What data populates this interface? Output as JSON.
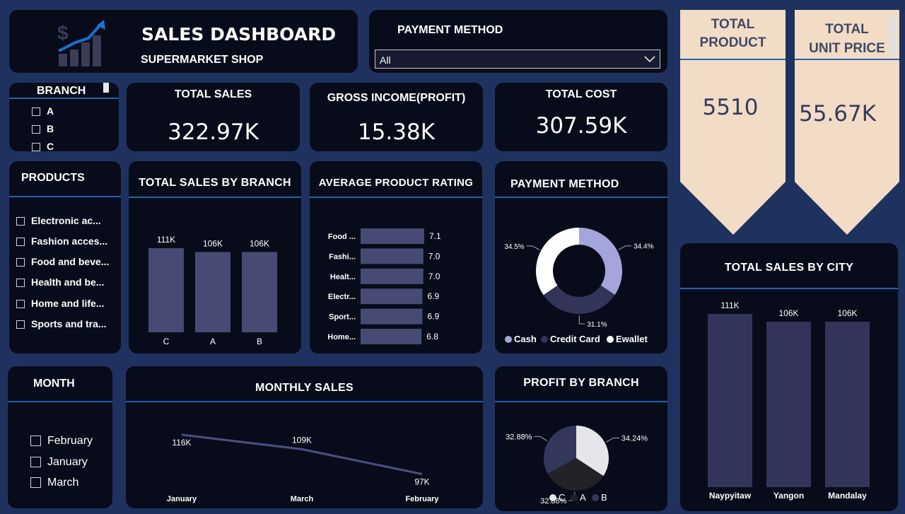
{
  "header": {
    "title": "SALES DASHBOARD",
    "subtitle": "SUPERMARKET SHOP",
    "icon": "sales-growth-icon"
  },
  "payment_filter": {
    "label": "PAYMENT METHOD",
    "selected": "All"
  },
  "branch_slicer": {
    "title": "BRANCH",
    "items": [
      "A",
      "B",
      "C"
    ]
  },
  "kpis": {
    "total_sales": {
      "label": "TOTAL SALES",
      "value": "322.97K"
    },
    "gross_income": {
      "label": "GROSS INCOME(PROFIT)",
      "value": "15.38K"
    },
    "total_cost": {
      "label": "TOTAL COST",
      "value": "307.59K"
    },
    "total_product": {
      "label_line1": "TOTAL",
      "label_line2": "PRODUCT",
      "value": "5510"
    },
    "total_unit_price": {
      "label_line1": "TOTAL",
      "label_line2": "UNIT PRICE",
      "value": "55.67K"
    }
  },
  "products_slicer": {
    "title": "PRODUCTS",
    "items": [
      "Electronic ac...",
      "Fashion acces...",
      "Food and beve...",
      "Health and be...",
      "Home and life...",
      "Sports and tra..."
    ]
  },
  "month_slicer": {
    "title": "MONTH",
    "items": [
      "February",
      "January",
      "March"
    ]
  },
  "colors": {
    "background": "#1f325f",
    "card": "#080c1a",
    "accent_line": "#1f63b4",
    "bar": "#474a74",
    "ribbon": "#f2dcc6"
  },
  "chart_data": [
    {
      "id": "sales_by_branch",
      "type": "bar",
      "title": "TOTAL SALES BY BRANCH",
      "categories": [
        "C",
        "A",
        "B"
      ],
      "values": [
        111,
        106,
        106
      ],
      "labels": [
        "111K",
        "106K",
        "106K"
      ],
      "unit": "K"
    },
    {
      "id": "avg_rating",
      "type": "bar",
      "orientation": "horizontal",
      "title": "AVERAGE PRODUCT RATING",
      "categories": [
        "Food ...",
        "Fashi...",
        "Healt...",
        "Electr...",
        "Sport...",
        "Home..."
      ],
      "values": [
        7.1,
        7.0,
        7.0,
        6.9,
        6.9,
        6.8
      ],
      "labels": [
        "7.1",
        "7.0",
        "7.0",
        "6.9",
        "6.9",
        "6.8"
      ]
    },
    {
      "id": "payment_method",
      "type": "pie",
      "donut": true,
      "title": "PAYMENT METHOD",
      "categories": [
        "Cash",
        "Credit Card",
        "Ewallet"
      ],
      "values": [
        34.4,
        31.1,
        34.5
      ],
      "labels": [
        "34.4%",
        "31.1%",
        "34.5%"
      ],
      "colors": [
        "#a3a6db",
        "#32345a",
        "#ffffff"
      ]
    },
    {
      "id": "monthly_sales",
      "type": "line",
      "title": "MONTHLY SALES",
      "categories": [
        "January",
        "March",
        "February"
      ],
      "values": [
        116,
        109,
        97
      ],
      "labels": [
        "116K",
        "109K",
        "97K"
      ],
      "unit": "K"
    },
    {
      "id": "profit_by_branch",
      "type": "pie",
      "title": "PROFIT BY BRANCH",
      "categories": [
        "C",
        "A",
        "B"
      ],
      "values": [
        34.24,
        32.88,
        32.88
      ],
      "labels": [
        "34.24%",
        "32.88%",
        "32.88%"
      ],
      "colors": [
        "#e6e6ea",
        "#232327",
        "#34375c"
      ]
    },
    {
      "id": "sales_by_city",
      "type": "bar",
      "title": "TOTAL SALES BY CITY",
      "categories": [
        "Naypyitaw",
        "Yangon",
        "Mandalay"
      ],
      "values": [
        111,
        106,
        106
      ],
      "labels": [
        "111K",
        "106K",
        "106K"
      ],
      "unit": "K"
    }
  ]
}
